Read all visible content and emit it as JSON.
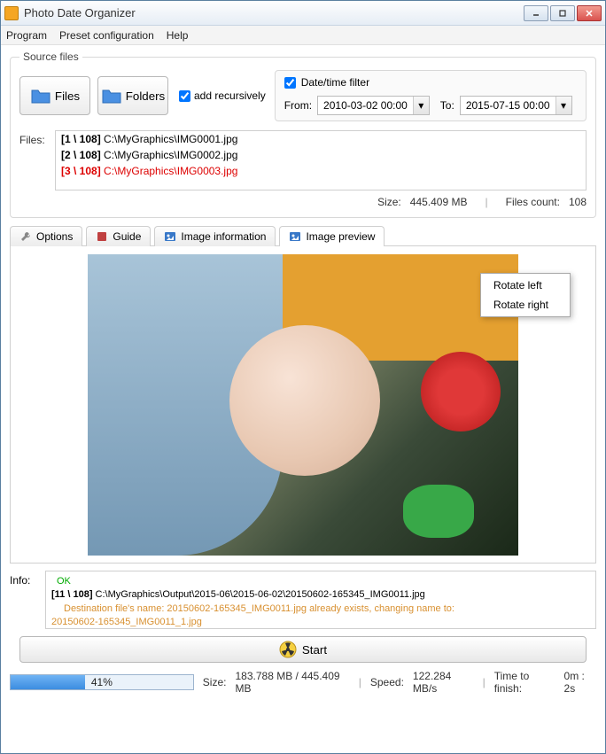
{
  "window": {
    "title": "Photo Date Organizer"
  },
  "menu": {
    "program": "Program",
    "preset": "Preset configuration",
    "help": "Help"
  },
  "source": {
    "legend": "Source files",
    "files_btn": "Files",
    "folders_btn": "Folders",
    "recursive": "add recursively",
    "filter": {
      "label": "Date/time filter",
      "from_label": "From:",
      "from_value": "2010-03-02 00:00",
      "to_label": "To:",
      "to_value": "2015-07-15 00:00"
    },
    "files_label": "Files:",
    "files": [
      {
        "idx": "[1 \\ 108]",
        "path": "C:\\MyGraphics\\IMG0001.jpg",
        "sel": false
      },
      {
        "idx": "[2 \\ 108]",
        "path": "C:\\MyGraphics\\IMG0002.jpg",
        "sel": false
      },
      {
        "idx": "[3 \\ 108]",
        "path": "C:\\MyGraphics\\IMG0003.jpg",
        "sel": true
      }
    ],
    "size_label": "Size:",
    "size_value": "445.409 MB",
    "count_label": "Files count:",
    "count_value": "108"
  },
  "tabs": {
    "options": "Options",
    "guide": "Guide",
    "imageinfo": "Image information",
    "preview": "Image preview"
  },
  "context": {
    "rotate_left": "Rotate left",
    "rotate_right": "Rotate right"
  },
  "info": {
    "label": "Info:",
    "ok": "OK",
    "line1_idx": "[11 \\ 108]",
    "line1_path": "C:\\MyGraphics\\Output\\2015-06\\2015-06-02\\20150602-165345_IMG0011.jpg",
    "warn1": "Destination file's name: 20150602-165345_IMG0011.jpg already exists, changing name to:",
    "warn2": "20150602-165345_IMG0011_1.jpg"
  },
  "start_label": "Start",
  "bottom": {
    "progress_pct": "41%",
    "progress_fill": "41%",
    "size_label": "Size:",
    "size_value": "183.788 MB  /  445.409 MB",
    "speed_label": "Speed:",
    "speed_value": "122.284 MB/s",
    "ttf_label": "Time to finish:",
    "ttf_value": "0m : 2s"
  }
}
